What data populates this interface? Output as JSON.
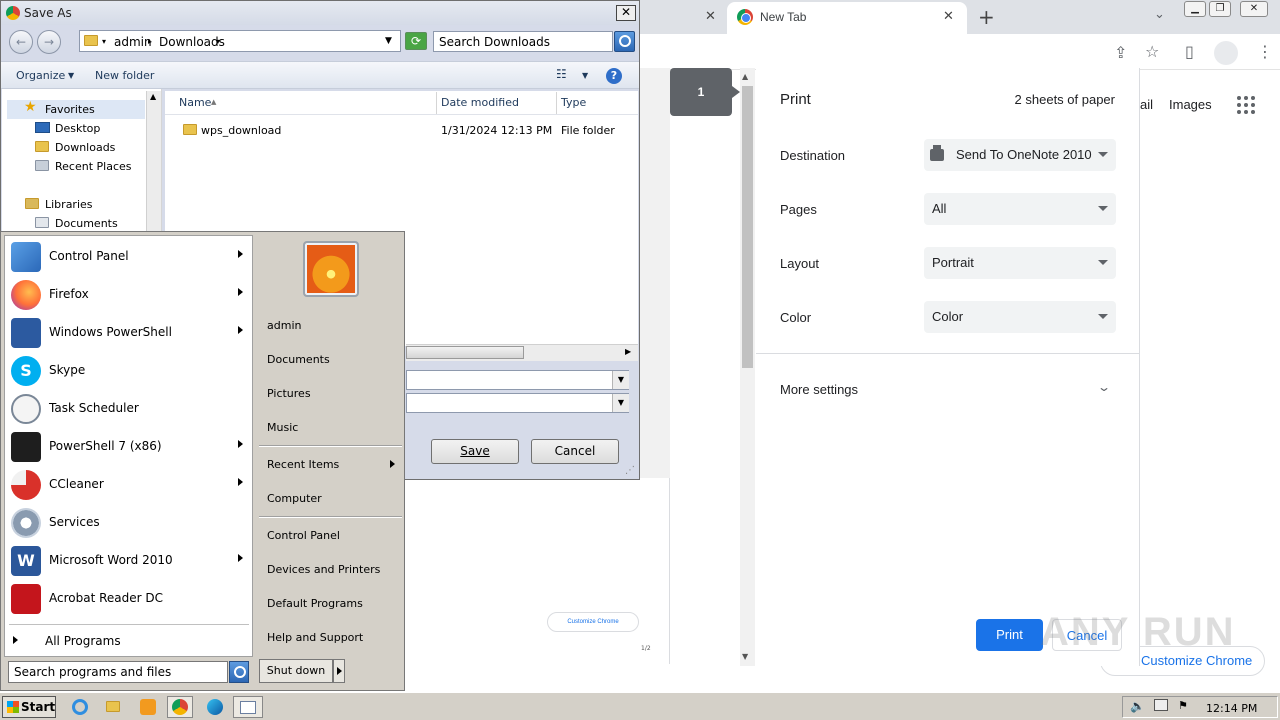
{
  "chrome": {
    "tab_title": "New Tab",
    "google_links": [
      "ail",
      "Images"
    ],
    "customize_button": "Customize Chrome",
    "customize_mini": "Customize Chrome",
    "preview_page_number": "1/2"
  },
  "print": {
    "title": "Print",
    "sheets": "2 sheets of paper",
    "page_badge": "1",
    "settings": [
      {
        "label": "Destination",
        "value": "Send To OneNote 2010"
      },
      {
        "label": "Pages",
        "value": "All"
      },
      {
        "label": "Layout",
        "value": "Portrait"
      },
      {
        "label": "Color",
        "value": "Color"
      }
    ],
    "more_settings": "More settings",
    "print_button": "Print",
    "cancel_button": "Cancel"
  },
  "save_as": {
    "title": "Save As",
    "breadcrumb": [
      "admin",
      "Downloads"
    ],
    "search_placeholder": "Search Downloads",
    "toolbar": {
      "organize": "Organize",
      "new_folder": "New folder"
    },
    "nav": [
      {
        "label": "Favorites"
      },
      {
        "label": "Desktop"
      },
      {
        "label": "Downloads"
      },
      {
        "label": "Recent Places"
      },
      {
        "label": "Libraries"
      },
      {
        "label": "Documents"
      }
    ],
    "columns": [
      "Name",
      "Date modified",
      "Type"
    ],
    "files": [
      {
        "name": "wps_download",
        "date": "1/31/2024 12:13 PM",
        "type": "File folder"
      }
    ],
    "save_button": "Save",
    "cancel_button": "Cancel"
  },
  "start_menu": {
    "programs": [
      {
        "label": "Control Panel",
        "icon": "control-panel-icon",
        "submenu": true
      },
      {
        "label": "Firefox",
        "icon": "firefox-icon",
        "submenu": true
      },
      {
        "label": "Windows PowerShell",
        "icon": "powershell-icon",
        "submenu": true
      },
      {
        "label": "Skype",
        "icon": "skype-icon",
        "submenu": false
      },
      {
        "label": "Task Scheduler",
        "icon": "task-scheduler-icon",
        "submenu": false
      },
      {
        "label": "PowerShell 7 (x86)",
        "icon": "powershell7-icon",
        "submenu": true
      },
      {
        "label": "CCleaner",
        "icon": "ccleaner-icon",
        "submenu": true
      },
      {
        "label": "Services",
        "icon": "services-icon",
        "submenu": false
      },
      {
        "label": "Microsoft Word 2010",
        "icon": "word-icon",
        "submenu": true
      },
      {
        "label": "Acrobat Reader DC",
        "icon": "acrobat-icon",
        "submenu": false
      }
    ],
    "all_programs": "All Programs",
    "search_placeholder": "Search programs and files",
    "right": {
      "user": "admin",
      "documents": "Documents",
      "pictures": "Pictures",
      "music": "Music",
      "recent_items": "Recent Items",
      "computer": "Computer",
      "control_panel": "Control Panel",
      "devices_printers": "Devices and Printers",
      "default_programs": "Default Programs",
      "help_support": "Help and Support"
    },
    "shutdown": "Shut down"
  },
  "taskbar": {
    "start": "Start",
    "clock": "12:14 PM"
  },
  "watermark": "ANY RUN"
}
